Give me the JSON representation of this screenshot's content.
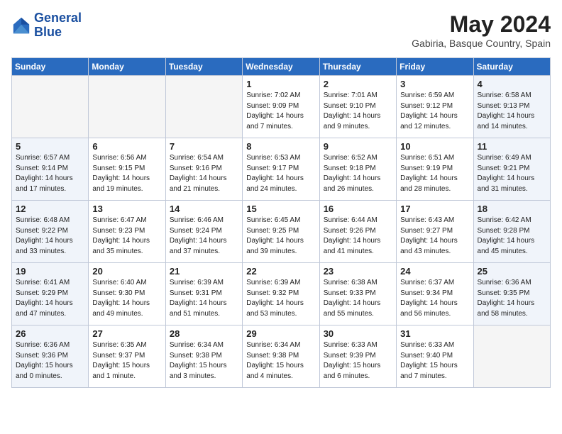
{
  "logo": {
    "line1": "General",
    "line2": "Blue"
  },
  "title": "May 2024",
  "subtitle": "Gabiria, Basque Country, Spain",
  "weekdays": [
    "Sunday",
    "Monday",
    "Tuesday",
    "Wednesday",
    "Thursday",
    "Friday",
    "Saturday"
  ],
  "weeks": [
    [
      {
        "day": "",
        "info": "",
        "empty": true
      },
      {
        "day": "",
        "info": "",
        "empty": true
      },
      {
        "day": "",
        "info": "",
        "empty": true
      },
      {
        "day": "1",
        "info": "Sunrise: 7:02 AM\nSunset: 9:09 PM\nDaylight: 14 hours\nand 7 minutes."
      },
      {
        "day": "2",
        "info": "Sunrise: 7:01 AM\nSunset: 9:10 PM\nDaylight: 14 hours\nand 9 minutes."
      },
      {
        "day": "3",
        "info": "Sunrise: 6:59 AM\nSunset: 9:12 PM\nDaylight: 14 hours\nand 12 minutes."
      },
      {
        "day": "4",
        "info": "Sunrise: 6:58 AM\nSunset: 9:13 PM\nDaylight: 14 hours\nand 14 minutes.",
        "weekend": true
      }
    ],
    [
      {
        "day": "5",
        "info": "Sunrise: 6:57 AM\nSunset: 9:14 PM\nDaylight: 14 hours\nand 17 minutes.",
        "weekend": true
      },
      {
        "day": "6",
        "info": "Sunrise: 6:56 AM\nSunset: 9:15 PM\nDaylight: 14 hours\nand 19 minutes."
      },
      {
        "day": "7",
        "info": "Sunrise: 6:54 AM\nSunset: 9:16 PM\nDaylight: 14 hours\nand 21 minutes."
      },
      {
        "day": "8",
        "info": "Sunrise: 6:53 AM\nSunset: 9:17 PM\nDaylight: 14 hours\nand 24 minutes."
      },
      {
        "day": "9",
        "info": "Sunrise: 6:52 AM\nSunset: 9:18 PM\nDaylight: 14 hours\nand 26 minutes."
      },
      {
        "day": "10",
        "info": "Sunrise: 6:51 AM\nSunset: 9:19 PM\nDaylight: 14 hours\nand 28 minutes."
      },
      {
        "day": "11",
        "info": "Sunrise: 6:49 AM\nSunset: 9:21 PM\nDaylight: 14 hours\nand 31 minutes.",
        "weekend": true
      }
    ],
    [
      {
        "day": "12",
        "info": "Sunrise: 6:48 AM\nSunset: 9:22 PM\nDaylight: 14 hours\nand 33 minutes.",
        "weekend": true
      },
      {
        "day": "13",
        "info": "Sunrise: 6:47 AM\nSunset: 9:23 PM\nDaylight: 14 hours\nand 35 minutes."
      },
      {
        "day": "14",
        "info": "Sunrise: 6:46 AM\nSunset: 9:24 PM\nDaylight: 14 hours\nand 37 minutes."
      },
      {
        "day": "15",
        "info": "Sunrise: 6:45 AM\nSunset: 9:25 PM\nDaylight: 14 hours\nand 39 minutes."
      },
      {
        "day": "16",
        "info": "Sunrise: 6:44 AM\nSunset: 9:26 PM\nDaylight: 14 hours\nand 41 minutes."
      },
      {
        "day": "17",
        "info": "Sunrise: 6:43 AM\nSunset: 9:27 PM\nDaylight: 14 hours\nand 43 minutes."
      },
      {
        "day": "18",
        "info": "Sunrise: 6:42 AM\nSunset: 9:28 PM\nDaylight: 14 hours\nand 45 minutes.",
        "weekend": true
      }
    ],
    [
      {
        "day": "19",
        "info": "Sunrise: 6:41 AM\nSunset: 9:29 PM\nDaylight: 14 hours\nand 47 minutes.",
        "weekend": true
      },
      {
        "day": "20",
        "info": "Sunrise: 6:40 AM\nSunset: 9:30 PM\nDaylight: 14 hours\nand 49 minutes."
      },
      {
        "day": "21",
        "info": "Sunrise: 6:39 AM\nSunset: 9:31 PM\nDaylight: 14 hours\nand 51 minutes."
      },
      {
        "day": "22",
        "info": "Sunrise: 6:39 AM\nSunset: 9:32 PM\nDaylight: 14 hours\nand 53 minutes."
      },
      {
        "day": "23",
        "info": "Sunrise: 6:38 AM\nSunset: 9:33 PM\nDaylight: 14 hours\nand 55 minutes."
      },
      {
        "day": "24",
        "info": "Sunrise: 6:37 AM\nSunset: 9:34 PM\nDaylight: 14 hours\nand 56 minutes."
      },
      {
        "day": "25",
        "info": "Sunrise: 6:36 AM\nSunset: 9:35 PM\nDaylight: 14 hours\nand 58 minutes.",
        "weekend": true
      }
    ],
    [
      {
        "day": "26",
        "info": "Sunrise: 6:36 AM\nSunset: 9:36 PM\nDaylight: 15 hours\nand 0 minutes.",
        "weekend": true
      },
      {
        "day": "27",
        "info": "Sunrise: 6:35 AM\nSunset: 9:37 PM\nDaylight: 15 hours\nand 1 minute."
      },
      {
        "day": "28",
        "info": "Sunrise: 6:34 AM\nSunset: 9:38 PM\nDaylight: 15 hours\nand 3 minutes."
      },
      {
        "day": "29",
        "info": "Sunrise: 6:34 AM\nSunset: 9:38 PM\nDaylight: 15 hours\nand 4 minutes."
      },
      {
        "day": "30",
        "info": "Sunrise: 6:33 AM\nSunset: 9:39 PM\nDaylight: 15 hours\nand 6 minutes."
      },
      {
        "day": "31",
        "info": "Sunrise: 6:33 AM\nSunset: 9:40 PM\nDaylight: 15 hours\nand 7 minutes."
      },
      {
        "day": "",
        "info": "",
        "empty": true
      }
    ]
  ]
}
